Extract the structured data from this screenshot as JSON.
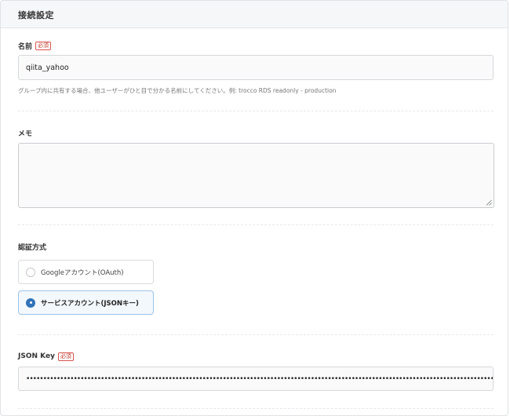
{
  "section": {
    "title": "接続設定"
  },
  "name_field": {
    "label": "名前",
    "required_badge": "必須",
    "value": "qiita_yahoo",
    "help": "グループ内に共有する場合、他ユーザーがひと目で分かる名前にしてください。例: trocco RDS readonly - production"
  },
  "memo_field": {
    "label": "メモ",
    "value": ""
  },
  "auth_method": {
    "label": "認証方式",
    "options": [
      {
        "label": "Googleアカウント(OAuth)",
        "selected": false
      },
      {
        "label": "サービスアカウント(JSONキー)",
        "selected": true
      }
    ]
  },
  "json_key_field": {
    "label": "JSON Key",
    "required_badge": "必須",
    "masked_value": "••••••••••••••••••••••••••••••••••••••••••••••••••••••••••••••••••••••••••••••••••••••••••••••••••••••••••••••••••••••••••••••••••••••••••••"
  },
  "colors": {
    "accent": "#2f73b8",
    "required": "#d9534f",
    "header_bg": "#f6f7f8"
  }
}
